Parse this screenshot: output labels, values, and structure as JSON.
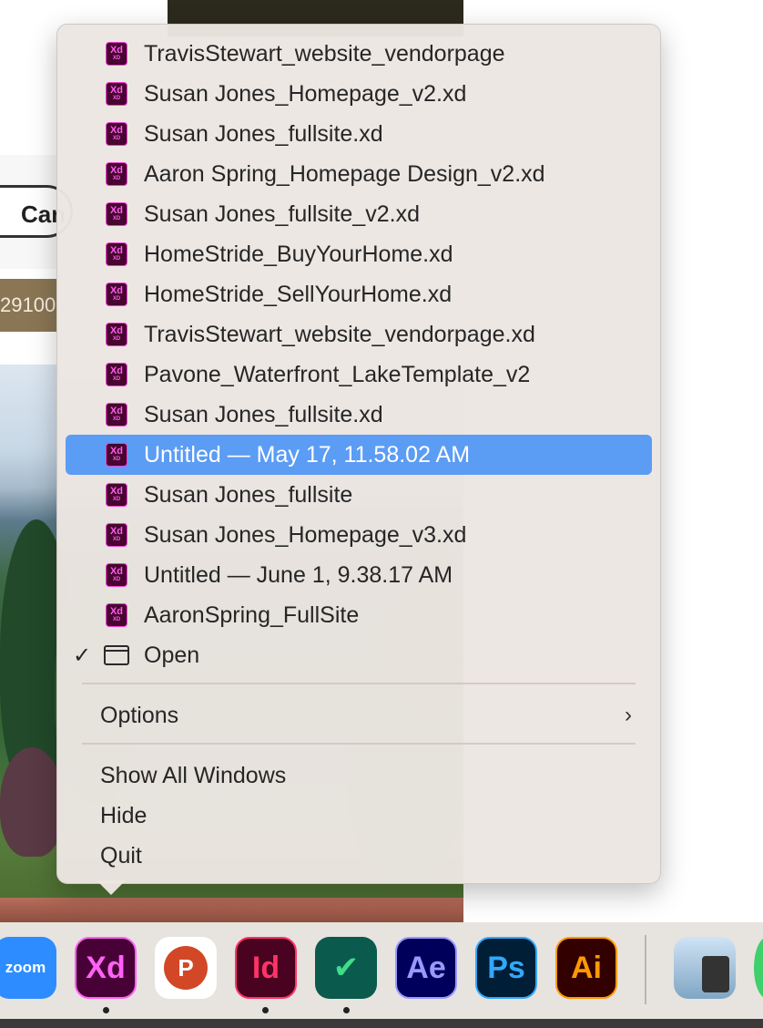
{
  "background": {
    "can_button_label": "Can",
    "price_text": "29100"
  },
  "menu": {
    "recent_files": [
      {
        "label": "TravisStewart_website_vendorpage"
      },
      {
        "label": "Susan Jones_Homepage_v2.xd"
      },
      {
        "label": "Susan Jones_fullsite.xd"
      },
      {
        "label": "Aaron Spring_Homepage Design_v2.xd"
      },
      {
        "label": "Susan Jones_fullsite_v2.xd"
      },
      {
        "label": "HomeStride_BuyYourHome.xd"
      },
      {
        "label": "HomeStride_SellYourHome.xd"
      },
      {
        "label": "TravisStewart_website_vendorpage.xd"
      },
      {
        "label": "Pavone_Waterfront_LakeTemplate_v2"
      },
      {
        "label": "Susan Jones_fullsite.xd"
      },
      {
        "label": "Untitled — May 17, 11.58.02 AM"
      },
      {
        "label": "Susan Jones_fullsite"
      },
      {
        "label": "Susan Jones_Homepage_v3.xd"
      },
      {
        "label": "Untitled — June 1, 9.38.17 AM"
      },
      {
        "label": "AaronSpring_FullSite"
      }
    ],
    "highlighted_index": 10,
    "file_icon_top": "Xd",
    "file_icon_bottom": "XD",
    "open_check": "✓",
    "open_label": "Open",
    "options_label": "Options",
    "options_chevron": "›",
    "show_all_windows_label": "Show All Windows",
    "hide_label": "Hide",
    "quit_label": "Quit"
  },
  "dock": {
    "apps": [
      {
        "name": "zoom",
        "label": "zoom",
        "bg": "#2d8cff",
        "fg": "#ffffff",
        "running": false
      },
      {
        "name": "adobe-xd",
        "label": "Xd",
        "bg": "#470137",
        "fg": "#ff61f6",
        "running": true
      },
      {
        "name": "powerpoint",
        "label": "P",
        "bg": "#ffffff",
        "fg": "#c43e1c",
        "running": false
      },
      {
        "name": "indesign",
        "label": "Id",
        "bg": "#49021f",
        "fg": "#ff3366",
        "running": true
      },
      {
        "name": "ticktick",
        "label": "✔",
        "bg": "#0b5a4e",
        "fg": "#3fdc8a",
        "running": true
      },
      {
        "name": "after-effects",
        "label": "Ae",
        "bg": "#00005b",
        "fg": "#9999ff",
        "running": false
      },
      {
        "name": "photoshop",
        "label": "Ps",
        "bg": "#001e36",
        "fg": "#31a8ff",
        "running": false
      },
      {
        "name": "illustrator",
        "label": "Ai",
        "bg": "#330000",
        "fg": "#ff9a00",
        "running": false
      }
    ]
  },
  "colors": {
    "highlight": "#5b9cf4",
    "menu_bg": "#ece6e2",
    "xd_icon_border": "#f33cd8",
    "xd_icon_bg": "#47052f"
  }
}
